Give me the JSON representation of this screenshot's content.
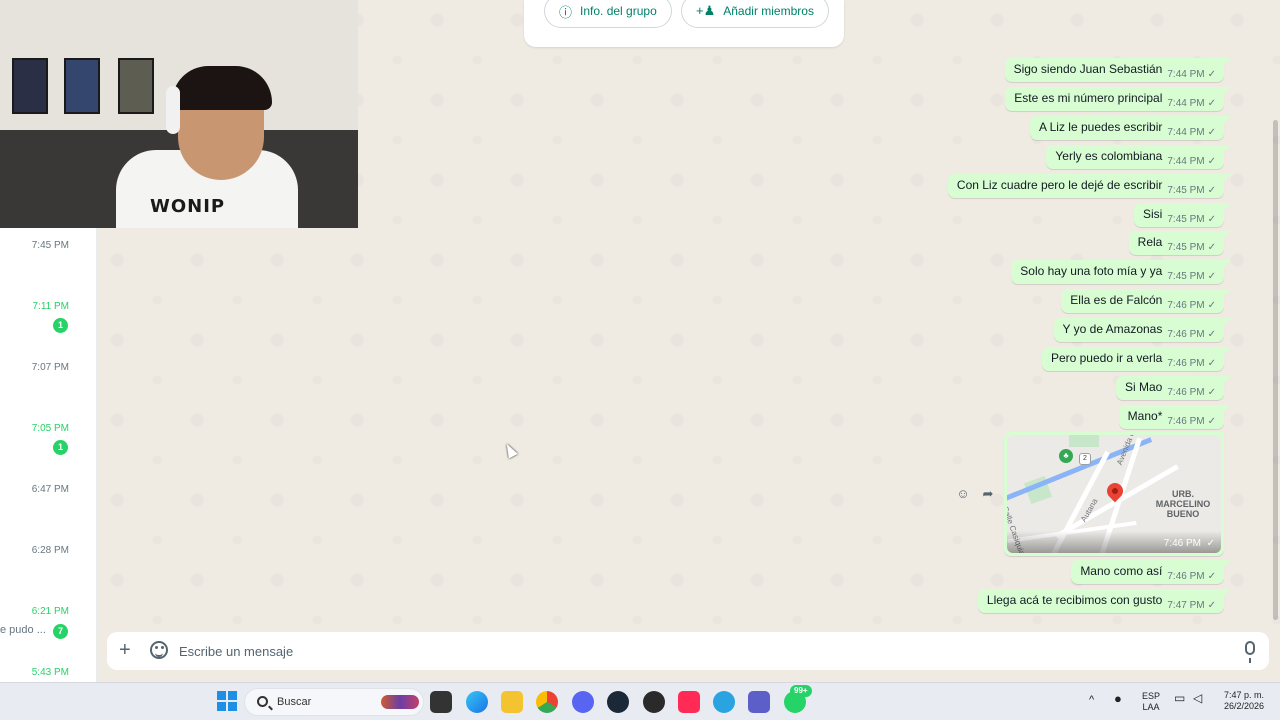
{
  "group_card": {
    "info_label": "Info. del grupo",
    "add_label": "Añadir miembros"
  },
  "chat_list": [
    {
      "time": "7:45 PM",
      "unread": "",
      "preview": "",
      "highlight": false
    },
    {
      "time": "7:11 PM",
      "unread": "1",
      "preview": "",
      "highlight": true
    },
    {
      "time": "7:07 PM",
      "unread": "",
      "preview": "",
      "highlight": false
    },
    {
      "time": "7:05 PM",
      "unread": "1",
      "preview": "",
      "highlight": true
    },
    {
      "time": "6:47 PM",
      "unread": "",
      "preview": "",
      "highlight": false
    },
    {
      "time": "6:28 PM",
      "unread": "",
      "preview": "",
      "highlight": false
    },
    {
      "time": "6:21 PM",
      "unread": "7",
      "preview": "e pudo ...",
      "highlight": true
    },
    {
      "time": "5:43 PM",
      "unread": "",
      "preview": "",
      "highlight": true
    }
  ],
  "messages": [
    {
      "text": "Sigo siendo Juan Sebastián",
      "time": "7:44 PM"
    },
    {
      "text": "Este es mi número principal",
      "time": "7:44 PM"
    },
    {
      "text": "A Liz le puedes escribir",
      "time": "7:44 PM"
    },
    {
      "text": "Yerly es colombiana",
      "time": "7:44 PM"
    },
    {
      "text": "Con Liz cuadre pero le dejé de escribir",
      "time": "7:45 PM"
    },
    {
      "text": "Sisi",
      "time": "7:45 PM"
    },
    {
      "text": "Rela",
      "time": "7:45 PM"
    },
    {
      "text": "Solo hay una foto mía y ya",
      "time": "7:45 PM"
    },
    {
      "text": "Ella es de Falcón",
      "time": "7:46 PM"
    },
    {
      "text": "Y yo de Amazonas",
      "time": "7:46 PM"
    },
    {
      "text": "Pero puedo ir a verla",
      "time": "7:46 PM"
    },
    {
      "text": "Si Mao",
      "time": "7:46 PM"
    },
    {
      "text": "Mano*",
      "time": "7:46 PM"
    }
  ],
  "location": {
    "time": "7:46 PM",
    "labels": {
      "district": "URB. MARCELINO BUENO",
      "street1": "Avenida Constitución",
      "street2": "Autana",
      "street3": "Calle Casiquiare",
      "route": "2"
    }
  },
  "messages_after": [
    {
      "text": "Mano como así",
      "time": "7:46 PM"
    },
    {
      "text": "Llega acá te recibimos con gusto",
      "time": "7:47 PM"
    }
  ],
  "composer": {
    "placeholder": "Escribe un mensaje"
  },
  "webcam": {
    "shirt_text": "WONIP"
  },
  "taskbar": {
    "search_label": "Buscar",
    "badge": "99+",
    "lang_top": "ESP",
    "lang_bottom": "LAA",
    "time": "7:47 p. m.",
    "date": "26/2/2026"
  },
  "colors": {
    "accent": "#008069",
    "bubble_out": "#d9fdd3",
    "chat_bg": "#efeae2",
    "unread": "#25d366"
  }
}
